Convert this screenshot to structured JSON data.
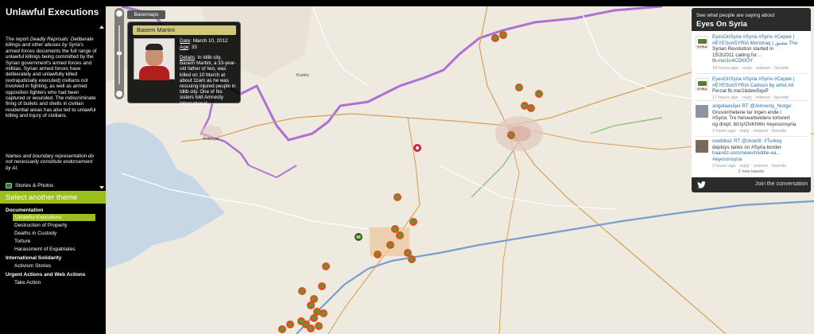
{
  "sidebar": {
    "title": "Unlawful Executions",
    "report_text": "The report Deadly Reprisals: Deliberate killings and other abuses by Syria's armed forces documents the full range of unlawful killings being committed by the Syrian government's armed forces and militias. Syrian armed forces have deliberately and unlawfully killed (extrajudicially executed) civilians not involved in fighting, as well as armed opposition fighters who had been captured or wounded. The indiscriminate firing of bullets and shells in civilian residential areas has also led to unlawful killing and injury of civilians.",
    "report_intro": "The report ",
    "report_title_italic": "Deadly Reprisals: Deliberate killings and other abuses by Syria's armed forces",
    "report_body": " documents the full range of unlawful killings being committed by the Syrian government's armed forces and militias. Syrian armed forces have deliberately and unlawfully killed (extrajudicially executed) civilians not involved in fighting, as well as armed opposition fighters who had been captured or wounded. The indiscriminate firing of bullets and shells in civilian residential areas has also led to unlawful killing and injury of civilians.",
    "disclaimer": "Names and boundary representation do not necessarily constitute endorsement by AI.",
    "stories_label": "Stories & Photos",
    "select_theme": "Select another theme",
    "menu": [
      {
        "label": "Documentation",
        "type": "header"
      },
      {
        "label": "Unlawful Executions",
        "type": "item",
        "active": true
      },
      {
        "label": "Destruction of Property",
        "type": "item"
      },
      {
        "label": "Deaths in Custody",
        "type": "item"
      },
      {
        "label": "Torture",
        "type": "item"
      },
      {
        "label": "Harassment of Expatriates",
        "type": "item"
      },
      {
        "label": "International Solidarity",
        "type": "header"
      },
      {
        "label": "Activism Stories",
        "type": "item"
      },
      {
        "label": "Urgent Actions and Web Actions",
        "type": "header"
      },
      {
        "label": "Take Action",
        "type": "item"
      }
    ]
  },
  "map": {
    "basemaps_label": "Basemaps",
    "places": [
      "Antakya",
      "Kumlu"
    ]
  },
  "popup": {
    "name": "Basem Martini",
    "date_label": "Date",
    "date_value": "March 10, 2012",
    "age_label": "Age",
    "age_value": "33",
    "details_label": "Details",
    "details_text": "In Idlib city, Basem Martini, a 33-year-old father of two, was killed on 10 March at about 11am as he was rescuing injured people in Idlib city. One of his sisters told Amnesty International:"
  },
  "twitter": {
    "subtitle": "See what people are saying about",
    "title": "Eyes On Syria",
    "tweets": [
      {
        "user": "EyesOnSyria",
        "text": "#Syria #Syrie #Сирия | #EYESonSYRIA Monshaq | مشنق The Syrian Revolution started in 15\\3\\2011 calling for... fb.me/1n4CDl0OY",
        "line1": "EyesOnSyria #Syria #Syrie #Сирия |",
        "line2": "#EYESonSYRIA Monshaq | مشنق The",
        "line3": "Syrian Revolution started in",
        "line4": "15\\3\\2011 calling for...",
        "line5": "fb.me/1n4CDl0OY",
        "meta": "18 hours ago · reply · retweet · favorite"
      },
      {
        "user": "EyesOnSyria",
        "line1": "EyesOnSyria #Syria #Syrie #Сирия |",
        "line2": "#EYESonSYRIA Cartoon by artist Ali",
        "line3": "Ferzat fb.me/1bdewSqsP",
        "meta": "17 hours ago · reply · retweet · favorite"
      },
      {
        "user": "angelaaskjer",
        "line1": "angelaaskjer RT @Amnesty_Norge:",
        "line2": "Grusomhetene tar ingen ende i",
        "line3": "#Syria: Tre helsearbeidere torturert",
        "line4": "og drept. bit.ly/OvKhWo #eyesonsyria",
        "meta": "2 hours ago · reply · retweet · favorite"
      },
      {
        "user": "cwebba1",
        "line1": "cwebba1 RT @ckoettl: #Turkey",
        "line2": "deploys tanks on #Syria border",
        "line3": "haaretz.com/news/middle-ea...",
        "line4": "#eyesonsyria",
        "meta": "2 hours ago · reply · retweet · favorite"
      }
    ],
    "new_tweets": "2 new tweets",
    "join_label": "Join the conversation"
  },
  "colors": {
    "accent": "#9bbf1e",
    "popup_header": "#d3c77d",
    "marker": "#d8541c",
    "border_line": "#a15ad0",
    "road": "#7a9ecf"
  }
}
